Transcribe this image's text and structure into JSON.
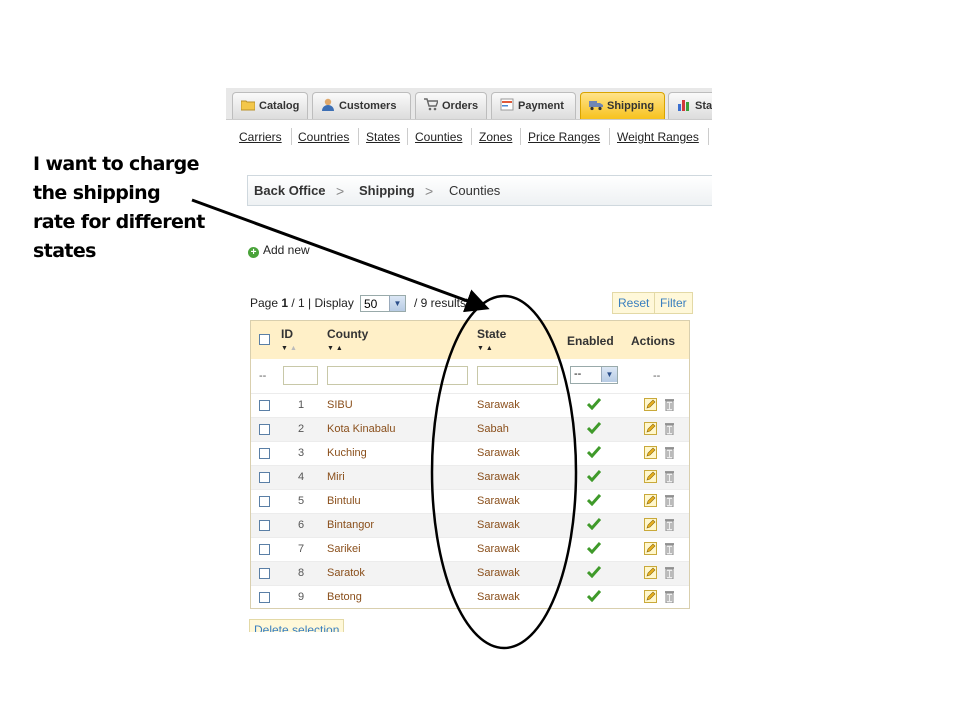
{
  "annotation": {
    "lines": [
      "I want to charge",
      "the shipping",
      "rate for different",
      "states"
    ]
  },
  "tabs": [
    {
      "label": "Catalog",
      "icon": "folder-icon"
    },
    {
      "label": "Customers",
      "icon": "user-icon"
    },
    {
      "label": "Orders",
      "icon": "cart-icon"
    },
    {
      "label": "Payment",
      "icon": "payment-icon"
    },
    {
      "label": "Shipping",
      "icon": "truck-icon",
      "active": true
    },
    {
      "label": "Sta",
      "icon": "stats-icon"
    }
  ],
  "subnav": [
    "Carriers",
    "Countries",
    "States",
    "Counties",
    "Zones",
    "Price Ranges",
    "Weight Ranges"
  ],
  "breadcrumb": {
    "root": "Back Office",
    "section": "Shipping",
    "page": "Counties",
    "separator": ">"
  },
  "add_new": "Add new",
  "pager": {
    "prefix": "Page ",
    "current": "1",
    "total": " / 1 | Display",
    "display_value": "50",
    "results": "/ 9 results)"
  },
  "buttons": {
    "reset": "Reset",
    "filter": "Filter",
    "delete_selection": "Delete selection"
  },
  "table": {
    "headers": {
      "id": "ID",
      "county": "County",
      "state": "State",
      "enabled": "Enabled",
      "actions": "Actions"
    },
    "filter": {
      "placeholder": "--",
      "enabled_value": "--",
      "actions_value": "--"
    },
    "rows": [
      {
        "id": "1",
        "county": "SIBU",
        "state": "Sarawak"
      },
      {
        "id": "2",
        "county": "Kota Kinabalu",
        "state": "Sabah"
      },
      {
        "id": "3",
        "county": "Kuching",
        "state": "Sarawak"
      },
      {
        "id": "4",
        "county": "Miri",
        "state": "Sarawak"
      },
      {
        "id": "5",
        "county": "Bintulu",
        "state": "Sarawak"
      },
      {
        "id": "6",
        "county": "Bintangor",
        "state": "Sarawak"
      },
      {
        "id": "7",
        "county": "Sarikei",
        "state": "Sarawak"
      },
      {
        "id": "8",
        "county": "Saratok",
        "state": "Sarawak"
      },
      {
        "id": "9",
        "county": "Betong",
        "state": "Sarawak"
      }
    ]
  },
  "colors": {
    "active_tab": "#f7c21e",
    "header_bg": "#fff0c8",
    "link_blue": "#3a7fbf",
    "row_text": "#8a4f1b",
    "check_green": "#3f9a2a"
  }
}
